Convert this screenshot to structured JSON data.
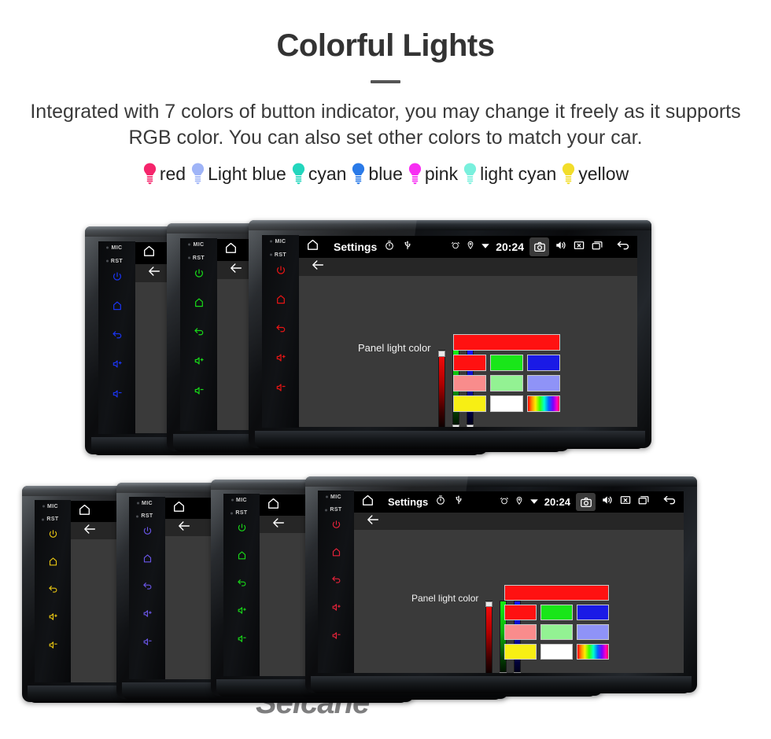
{
  "header": {
    "title": "Colorful Lights",
    "subtitle": "Integrated with 7 colors of button indicator, you may change it freely as it supports RGB color. You can also set other colors to match your car."
  },
  "legend": {
    "items": [
      {
        "label": "red",
        "color": "#f5246b"
      },
      {
        "label": "Light blue",
        "color": "#9fb4f7"
      },
      {
        "label": "cyan",
        "color": "#23d6bd"
      },
      {
        "label": "blue",
        "color": "#2a7ae8"
      },
      {
        "label": "pink",
        "color": "#f72df2"
      },
      {
        "label": "light cyan",
        "color": "#79f0dd"
      },
      {
        "label": "yellow",
        "color": "#f2dd2a"
      }
    ]
  },
  "screen_ui": {
    "status_bar": {
      "home_icon": "home-icon",
      "title": "Settings",
      "timer_icon": "stopwatch-icon",
      "usb_icon": "usb-icon",
      "alarm_icon": "alarm-clock-icon",
      "location_icon": "location-pin-icon",
      "wifi_icon": "wifi-icon",
      "time": "20:24",
      "camera_icon": "camera-icon",
      "volume_icon": "speaker-icon",
      "close_icon": "close-box-icon",
      "recents_icon": "recents-icon",
      "back_icon": "back-arrow-icon"
    },
    "sub_bar": {
      "back_icon": "back-arrow-icon"
    },
    "panel_light": {
      "label": "Panel light color",
      "sliders": [
        {
          "name": "red-slider",
          "value": 100
        },
        {
          "name": "green-slider",
          "value": 0
        },
        {
          "name": "blue-slider",
          "value": 0
        }
      ],
      "preview_color": "#ff1111",
      "swatch_rows": [
        [
          {
            "name": "swatch-red",
            "color": "#ff1111"
          },
          {
            "name": "swatch-green",
            "color": "#19e619"
          },
          {
            "name": "swatch-blue",
            "color": "#1a1ae6"
          }
        ],
        [
          {
            "name": "swatch-salmon",
            "color": "#f98c8c"
          },
          {
            "name": "swatch-lightgreen",
            "color": "#93f293"
          },
          {
            "name": "swatch-periwinkle",
            "color": "#8f93f7"
          }
        ],
        [
          {
            "name": "swatch-yellow",
            "color": "#f7ef14"
          },
          {
            "name": "swatch-white",
            "color": "#ffffff"
          },
          {
            "name": "swatch-rainbow",
            "color": "rainbow"
          }
        ]
      ]
    }
  },
  "units": {
    "keys": {
      "mic_label": "MIC",
      "rst_label": "RST",
      "icons": [
        "power-icon",
        "home-icon",
        "back-icon",
        "volume-up-icon",
        "volume-down-icon"
      ]
    },
    "top_group": [
      {
        "name": "head-unit-blue",
        "led_color": "#1a34f0"
      },
      {
        "name": "head-unit-green",
        "led_color": "#18d918"
      },
      {
        "name": "head-unit-red",
        "led_color": "#e81414"
      }
    ],
    "bottom_group": [
      {
        "name": "head-unit-yellow",
        "led_color": "#e8c512"
      },
      {
        "name": "head-unit-violet",
        "led_color": "#6a56e8"
      },
      {
        "name": "head-unit-green",
        "led_color": "#18d918"
      },
      {
        "name": "head-unit-red",
        "led_color": "#e8233a"
      }
    ]
  },
  "watermark": {
    "text": "Seicane"
  }
}
